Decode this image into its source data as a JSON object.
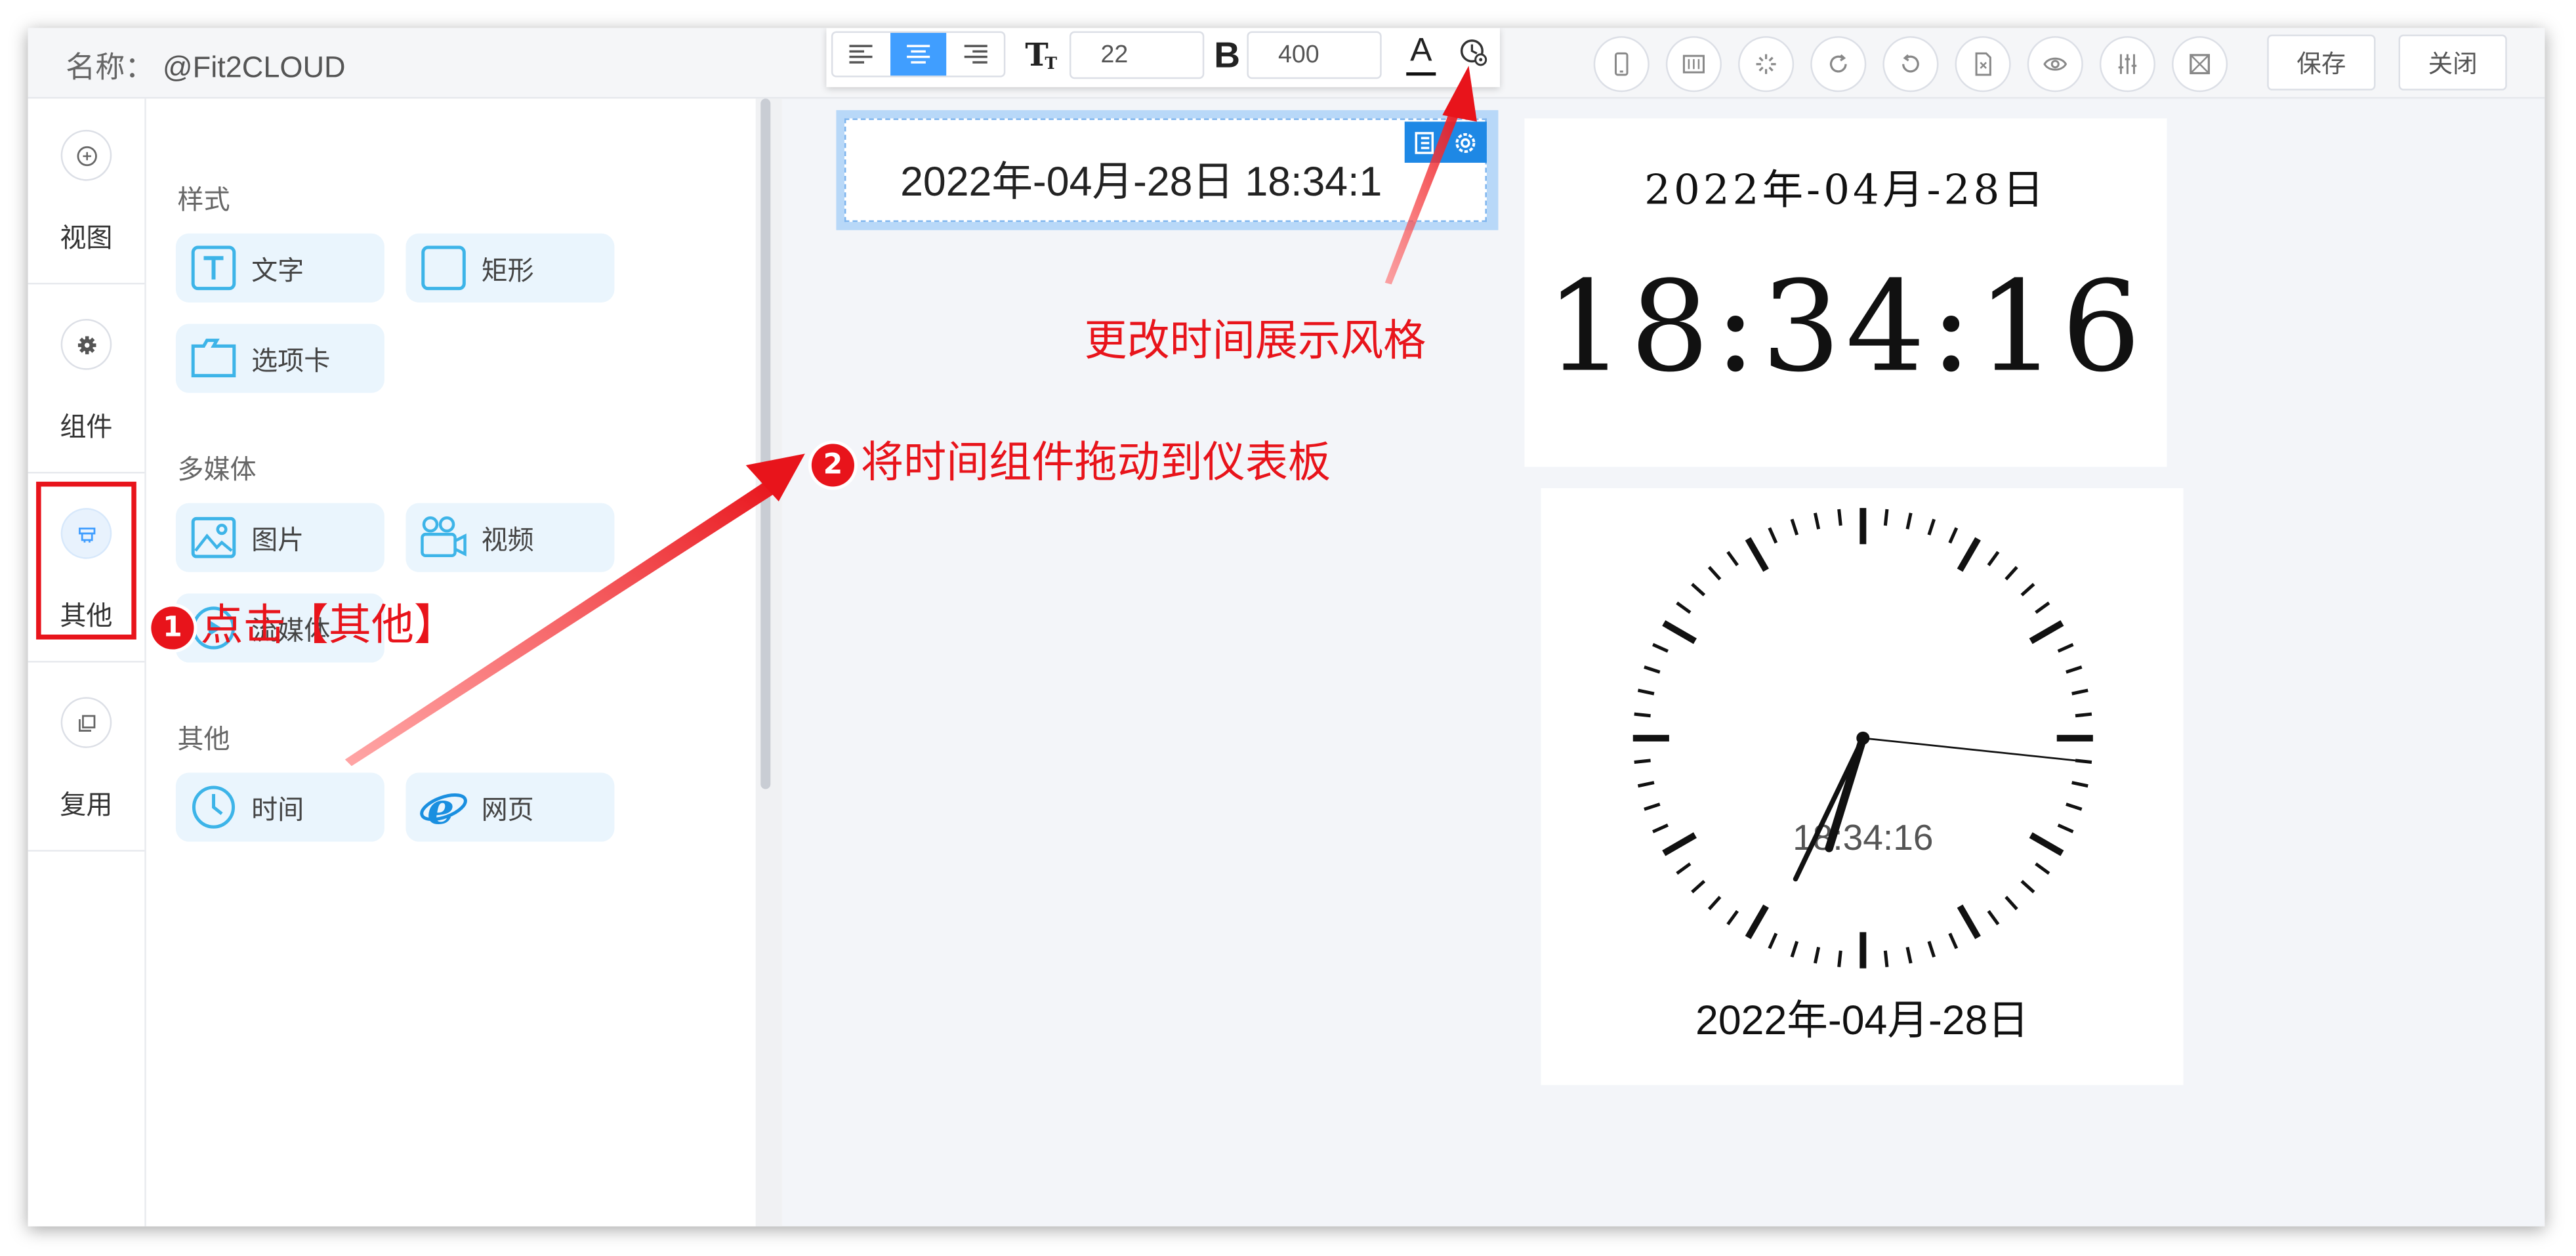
{
  "header": {
    "name_label": "名称：",
    "name_value": "@Fit2CLOUD",
    "save_label": "保存",
    "close_label": "关闭"
  },
  "format_toolbar": {
    "font_size": "22",
    "font_weight": "400",
    "bold_label": "B",
    "font_color_label": "A",
    "active_align": "center"
  },
  "nav": {
    "items": [
      {
        "label": "视图",
        "icon": "plus-circle-icon"
      },
      {
        "label": "组件",
        "icon": "gear-icon"
      },
      {
        "label": "其他",
        "icon": "other-icon",
        "active": true
      },
      {
        "label": "复用",
        "icon": "copy-icon"
      }
    ]
  },
  "panel": {
    "sections": [
      {
        "title": "样式",
        "items": [
          {
            "label": "文字"
          },
          {
            "label": "矩形"
          },
          {
            "label": "选项卡"
          }
        ]
      },
      {
        "title": "多媒体",
        "items": [
          {
            "label": "图片"
          },
          {
            "label": "视频"
          },
          {
            "label": "流媒体"
          }
        ]
      },
      {
        "title": "其他",
        "items": [
          {
            "label": "时间"
          },
          {
            "label": "网页"
          }
        ]
      }
    ]
  },
  "canvas": {
    "selected_time_text": "2022年-04月-28日 18:34:1",
    "digital_date": "2022年-04月-28日",
    "digital_time": "18:34:16",
    "analog_time": "18:34:16",
    "analog_date": "2022年-04月-28日",
    "clock": {
      "hour": 18,
      "minute": 34,
      "second": 16
    }
  },
  "annotations": {
    "step1_number": "1",
    "step1_text": "点击【其他】",
    "step2_number": "2",
    "step2_text": "将时间组件拖动到仪表板",
    "style_hint": "更改时间展示风格"
  },
  "colors": {
    "accent": "#409eff",
    "annotation_red": "#e8141b",
    "component_bg": "#eaf5fd"
  }
}
